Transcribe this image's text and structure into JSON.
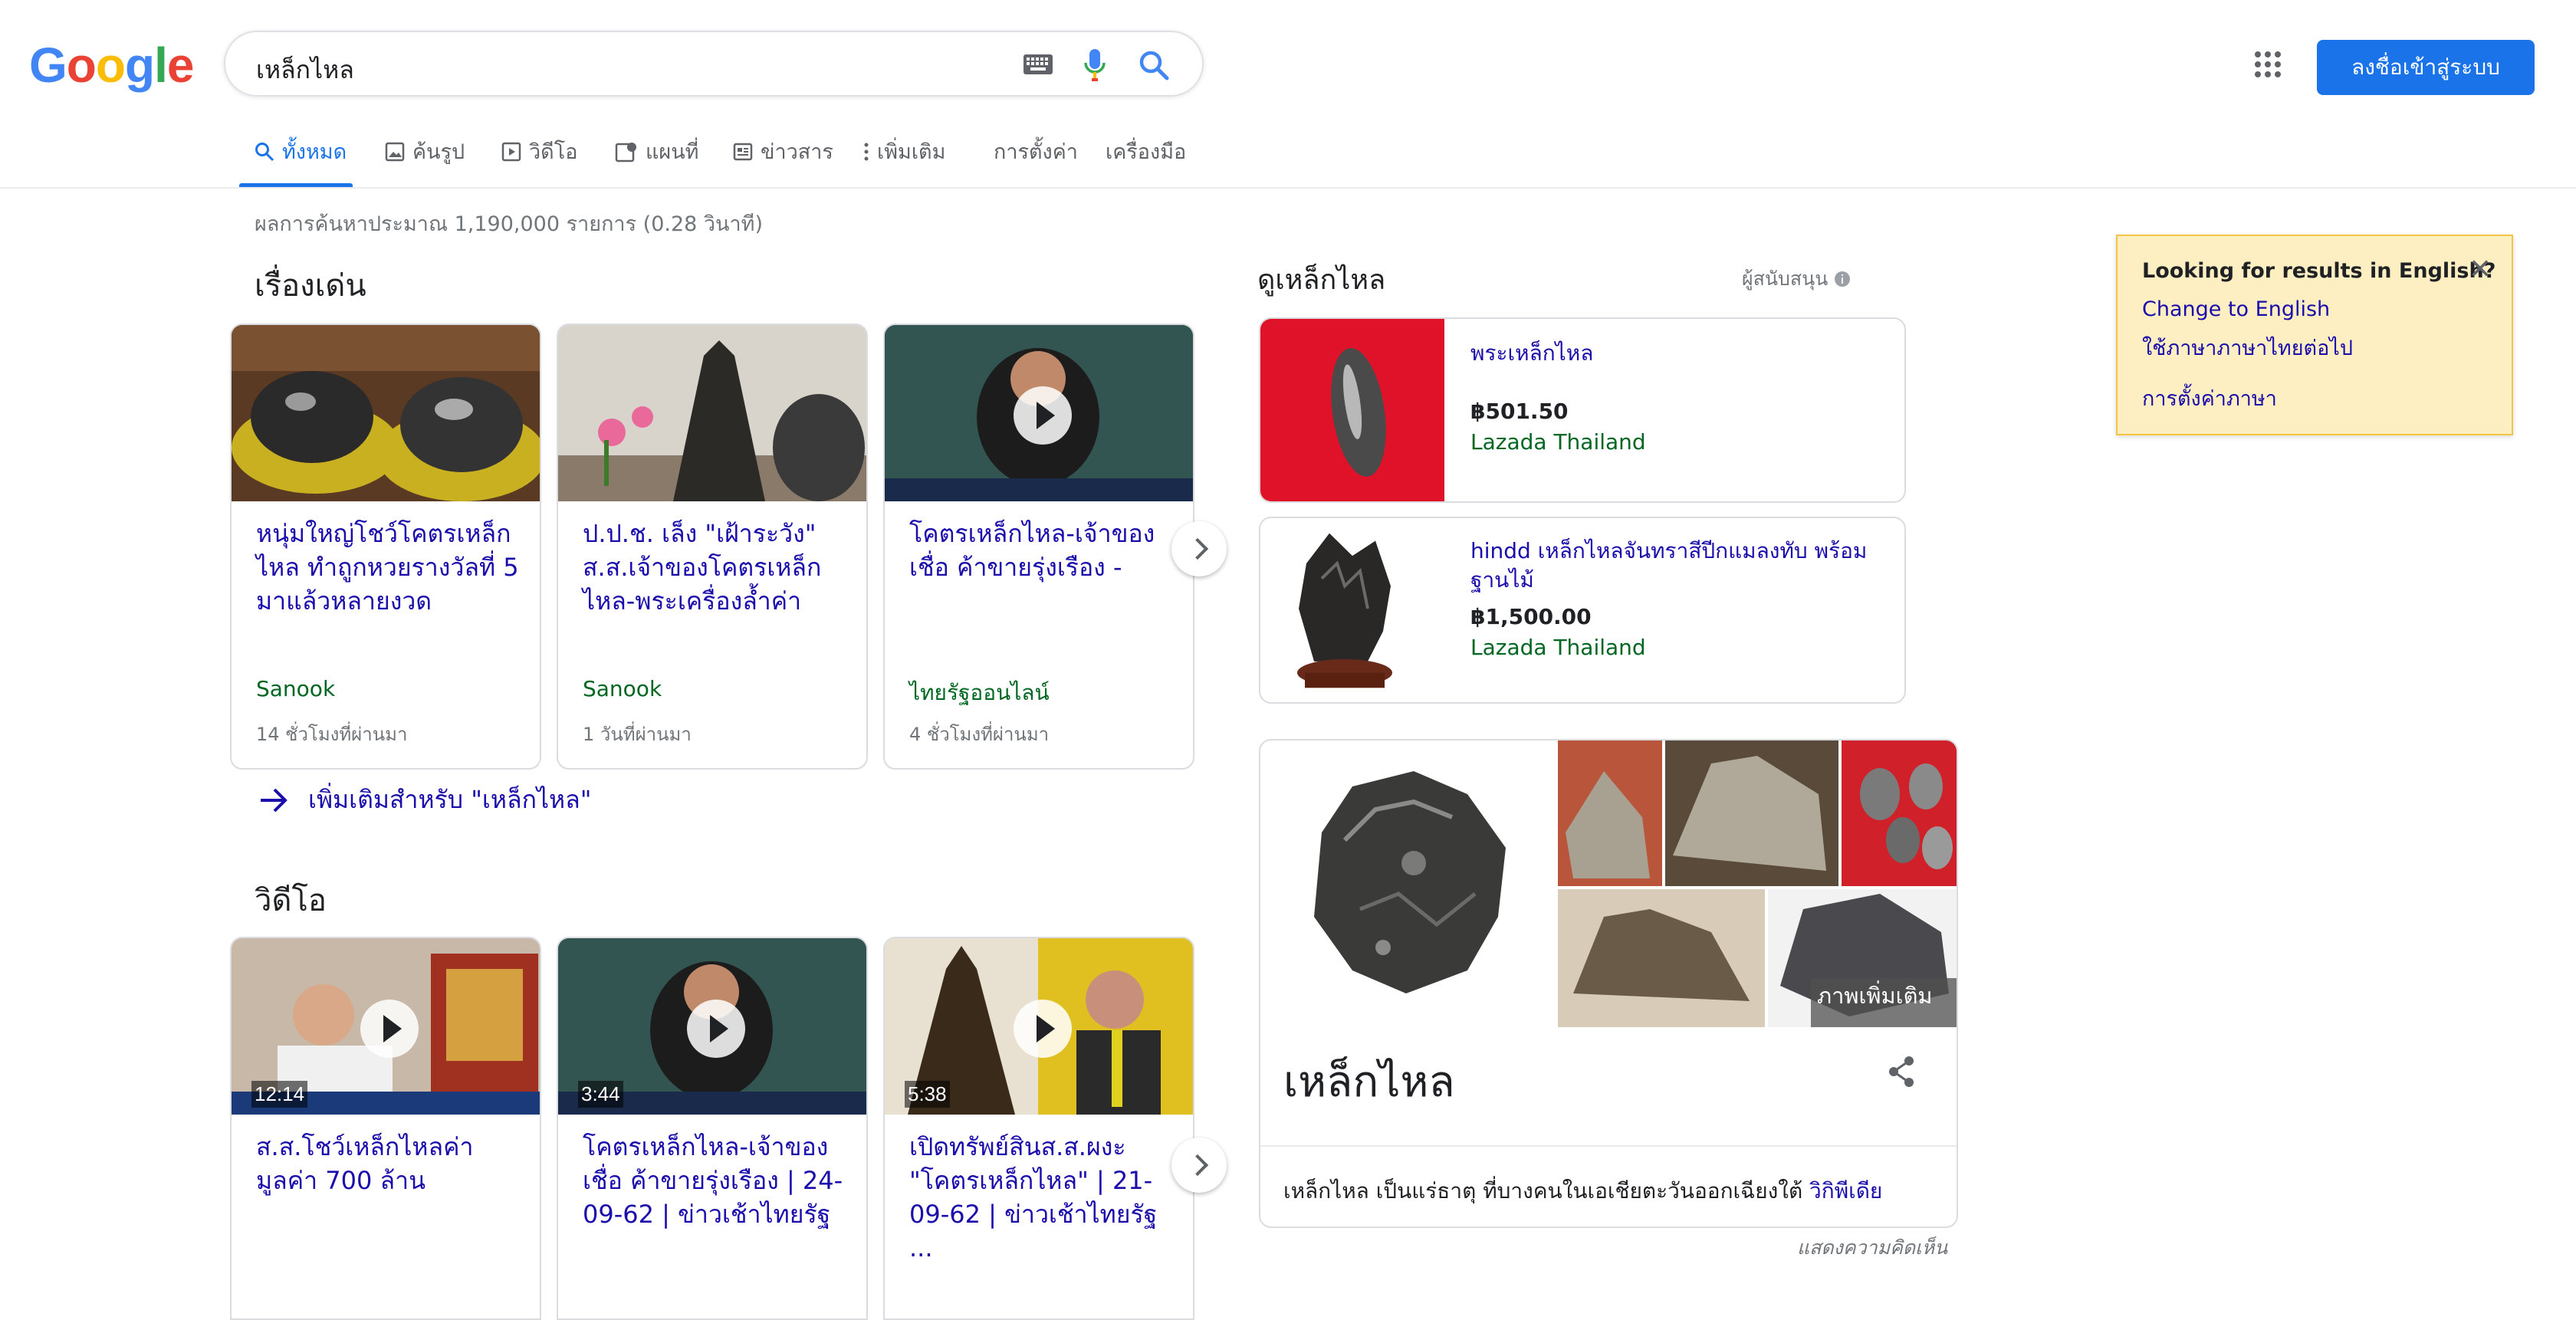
{
  "search": {
    "query": "เหล็กไหล"
  },
  "header": {
    "logo_letters": [
      "G",
      "o",
      "o",
      "g",
      "l",
      "e"
    ],
    "logo_colors": [
      "#4285F4",
      "#EA4335",
      "#FBBC05",
      "#4285F4",
      "#34A853",
      "#EA4335"
    ],
    "signin_label": "ลงชื่อเข้าสู่ระบบ"
  },
  "tabs": [
    "ทั้งหมด",
    "ค้นรูป",
    "วิดีโอ",
    "แผนที่",
    "ข่าวสาร",
    "เพิ่มเติม",
    "การตั้งค่า",
    "เครื่องมือ"
  ],
  "stats": "ผลการค้นหาประมาณ 1,190,000 รายการ (0.28 วินาที)",
  "top_stories": {
    "heading": "เรื่องเด่น",
    "cards": [
      {
        "title": "หนุ่มใหญ่โชว์โคตรเหล็กไหล ทำถูกหวยรางวัลที่ 5 มาแล้วหลายงวด",
        "source": "Sanook",
        "time": "14 ชั่วโมงที่ผ่านมา"
      },
      {
        "title": "ป.ป.ช. เล็ง \"เฝ้าระวัง\" ส.ส.เจ้าของโคตรเหล็กไหล-พระเครื่องล้ำค่า",
        "source": "Sanook",
        "time": "1 วันที่ผ่านมา"
      },
      {
        "title": "โคตรเหล็กไหล-เจ้าของเชื่อ ค้าขายรุ่งเรือง -",
        "source": "ไทยรัฐออนไลน์",
        "time": "4 ชั่วโมงที่ผ่านมา"
      }
    ],
    "more_link": "เพิ่มเติมสำหรับ \"เหล็กไหล\""
  },
  "videos": {
    "heading": "วิดีโอ",
    "cards": [
      {
        "title": "ส.ส.โชว์เหล็กไหลค่ามูลค่า 700 ล้าน",
        "duration": "12:14"
      },
      {
        "title": "โคตรเหล็กไหล-เจ้าของเชื่อ ค้าขายรุ่งเรือง | 24-09-62 | ข่าวเช้าไทยรัฐ",
        "duration": "3:44"
      },
      {
        "title": "เปิดทรัพย์สินส.ส.ผงะ \"โคตรเหล็กไหล\" | 21-09-62 | ข่าวเช้าไทยรัฐ ...",
        "duration": "5:38"
      }
    ]
  },
  "shopping": {
    "heading": "ดูเหล็กไหล",
    "sponsored": "ผู้สนับสนุน",
    "items": [
      {
        "name": "พระเหล็กไหล",
        "price": "฿501.50",
        "store": "Lazada Thailand"
      },
      {
        "name": "hindd เหล็กไหลจันทราสีปีกแมลงทับ พร้อมฐานไม้",
        "price": "฿1,500.00",
        "store": "Lazada Thailand"
      }
    ]
  },
  "knowledge": {
    "title": "เหล็กไหล",
    "more_images": "ภาพเพิ่มเติม",
    "description": "เหล็กไหล เป็นแร่ธาตุ ที่บางคนในเอเชียตะวันออกเฉียงใต้",
    "wiki_link": "วิกิพีเดีย",
    "feedback": "แสดงความคิดเห็น"
  },
  "language_prompt": {
    "title": "Looking for results in English?",
    "change": "Change to English",
    "keep": "ใช้ภาษาภาษาไทยต่อไป",
    "settings": "การตั้งค่าภาษา"
  }
}
